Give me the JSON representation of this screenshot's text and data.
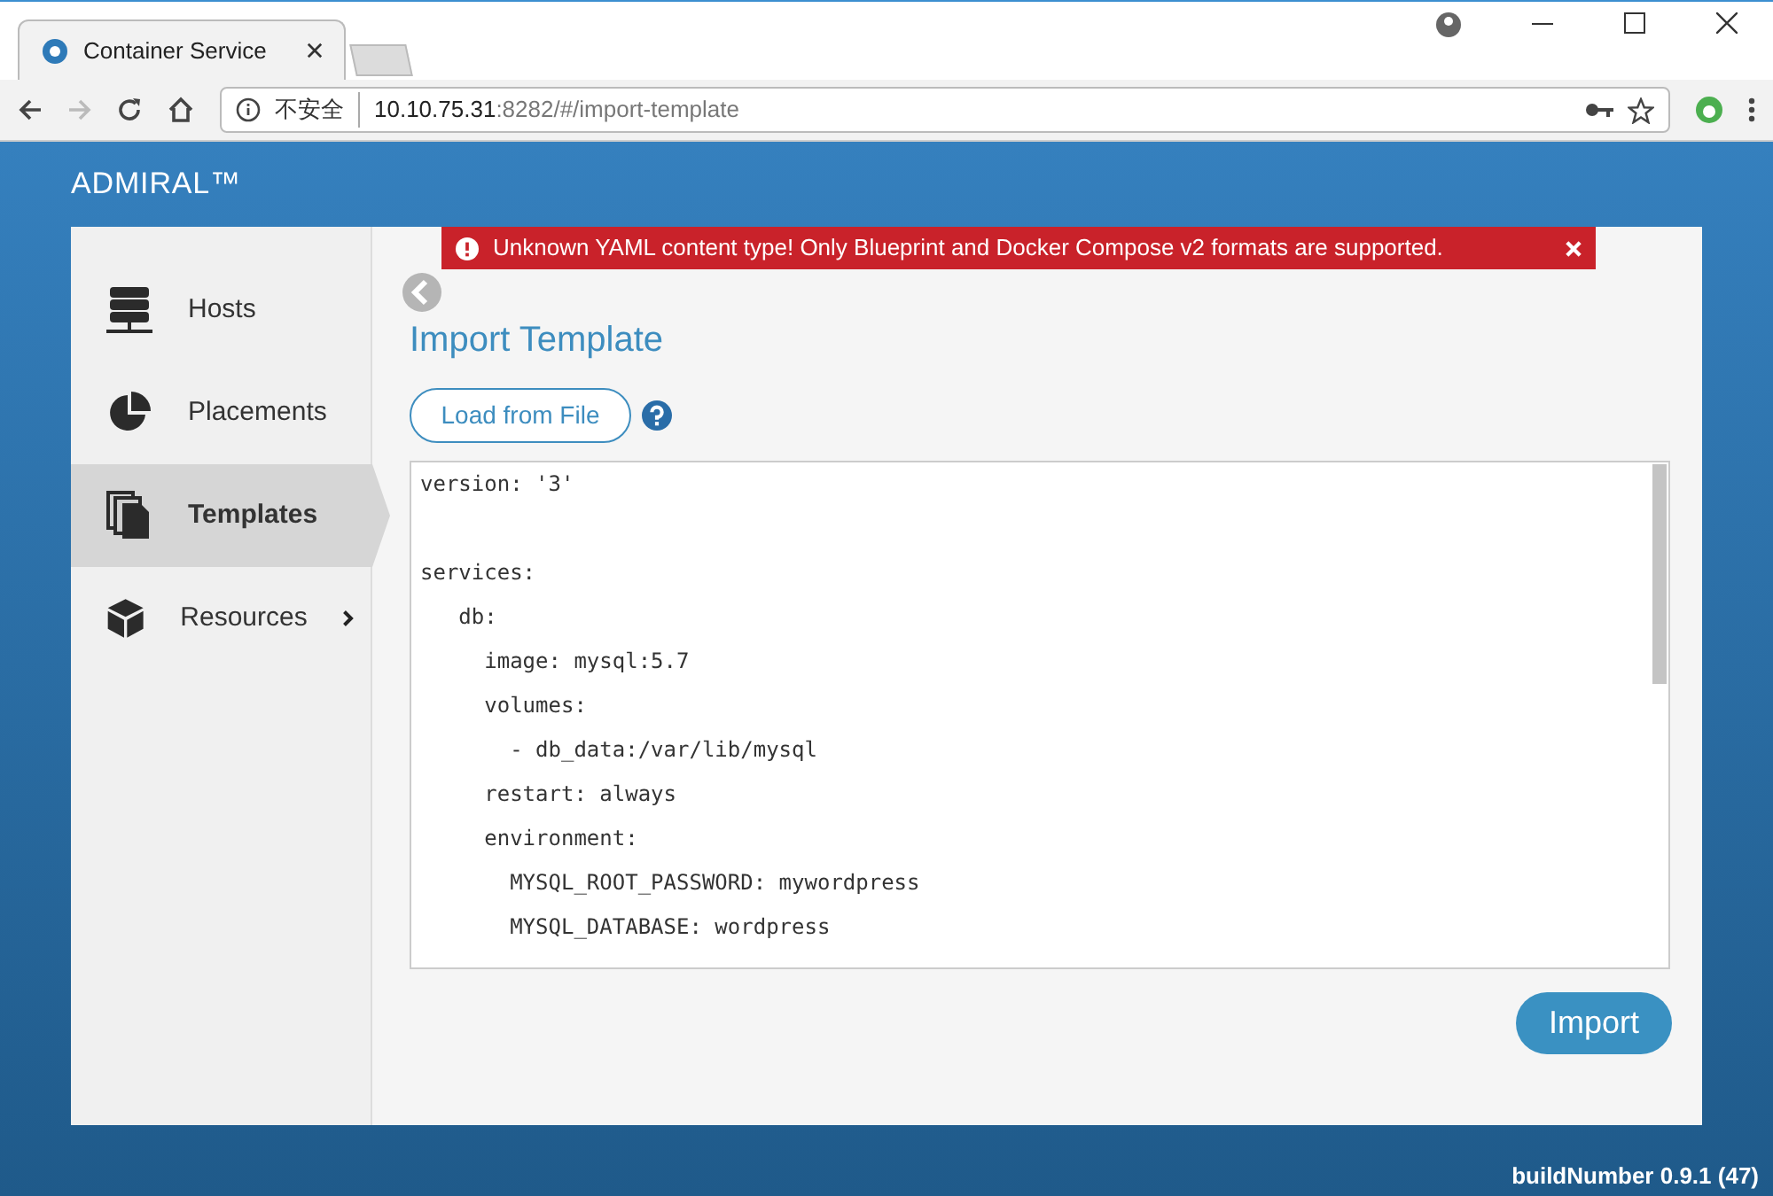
{
  "browser": {
    "tabs": [
      {
        "title": "Container Service",
        "selected": true
      }
    ],
    "address": {
      "security": "不安全",
      "host": "10.10.75.31",
      "rest": ":8282/#/import-template"
    }
  },
  "app": {
    "brand": "ADMIRAL™",
    "sidebar": [
      {
        "label": "Hosts",
        "selected": false,
        "has_submenu": false
      },
      {
        "label": "Placements",
        "selected": false,
        "has_submenu": false
      },
      {
        "label": "Templates",
        "selected": true,
        "has_submenu": false
      },
      {
        "label": "Resources",
        "selected": false,
        "has_submenu": true
      }
    ],
    "alert": {
      "message": "Unknown YAML content type! Only Blueprint and Docker Compose v2 formats are supported."
    },
    "title": "Import Template",
    "load_button": "Load from File",
    "editor": {
      "value": "version: '3'\n\nservices:\n   db:\n     image: mysql:5.7\n     volumes:\n       - db_data:/var/lib/mysql\n     restart: always\n     environment:\n       MYSQL_ROOT_PASSWORD: mywordpress\n       MYSQL_DATABASE: wordpress"
    },
    "import_button": "Import",
    "build": "buildNumber 0.9.1 (47)"
  }
}
